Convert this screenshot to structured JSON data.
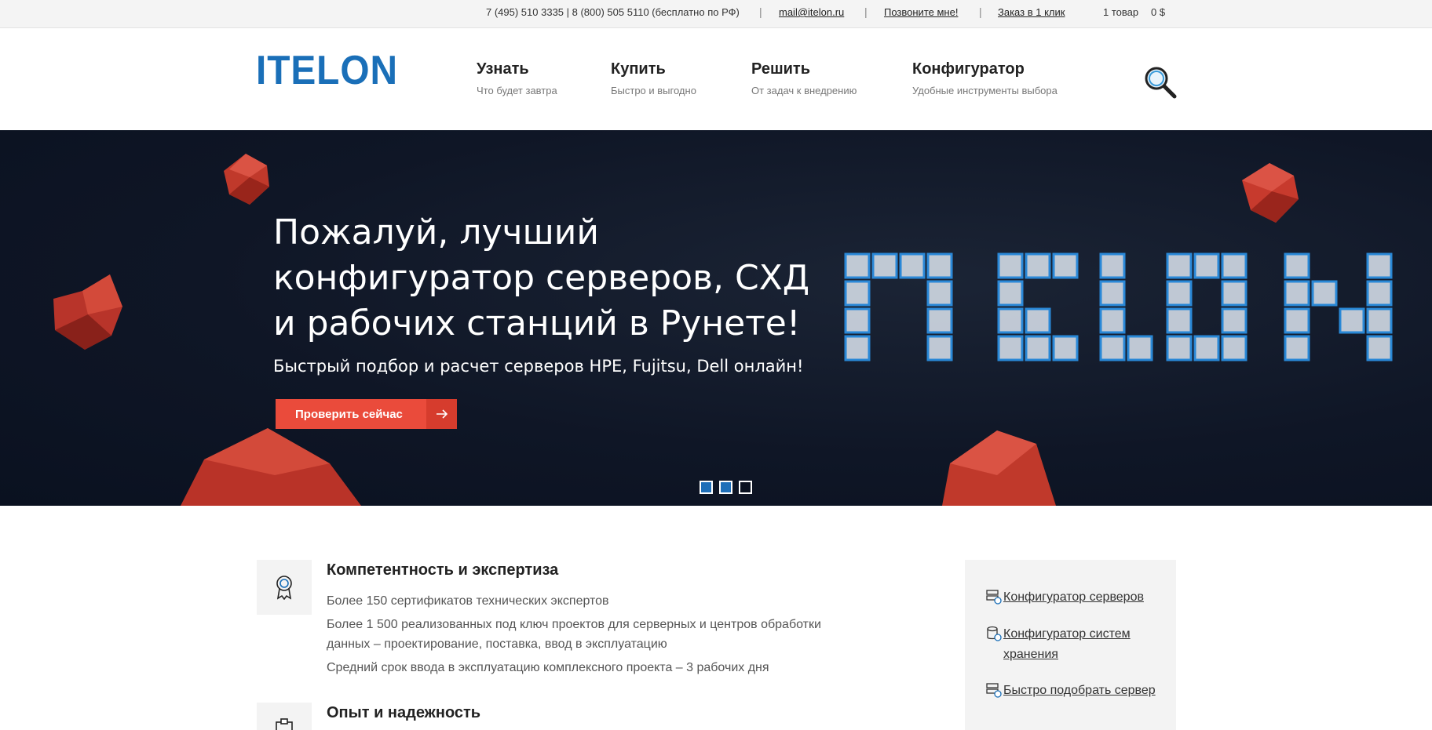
{
  "topbar": {
    "phones": "7 (495) 510 3335 | 8 (800) 505 5110 (бесплатно по РФ)",
    "email": "mail@itelon.ru",
    "callback": "Позвоните мне!",
    "one_click": "Заказ в 1 клик",
    "cart_count": "1 товар",
    "cart_total": "0 $",
    "separator": "|"
  },
  "header": {
    "logo": "ITELON",
    "nav": [
      {
        "title": "Узнать",
        "sub": "Что будет завтра"
      },
      {
        "title": "Купить",
        "sub": "Быстро и выгодно"
      },
      {
        "title": "Решить",
        "sub": "От задач к внедрению"
      },
      {
        "title": "Конфигуратор",
        "sub": "Удобные инструменты выбора"
      }
    ],
    "search_icon": "search-icon"
  },
  "hero": {
    "headline": "Пожалуй, лучший конфигуратор серверов, СХД и рабочих станций в Рунете!",
    "subtitle": "Быстрый подбор и расчет серверов HPE, Fujitsu, Dell онлайн!",
    "cta_label": "Проверить сейчас",
    "cta_icon": "arrow-right-icon",
    "slides": 3,
    "active_slide": 3,
    "accent_color": "#ea4b3b",
    "background_color": "#0f1626"
  },
  "features": [
    {
      "icon": "award-badge-icon",
      "title": "Компетентность и экспертиза",
      "lines": [
        "Более 150 сертификатов технических экспертов",
        "Более 1 500 реализованных под ключ проектов для серверных и центров обработки данных – проектирование, поставка, ввод в эксплуатацию",
        "Средний срок ввода в эксплуатацию комплексного проекта – 3 рабочих дня"
      ]
    },
    {
      "icon": "clipboard-icon",
      "title": "Опыт и надежность",
      "lines": []
    }
  ],
  "sidebar": {
    "links": [
      {
        "icon": "server-config-icon",
        "label": "Конфигуратор серверов"
      },
      {
        "icon": "storage-config-icon",
        "label": "Конфигуратор  систем хранения"
      },
      {
        "icon": "server-pick-icon",
        "label": "Быстро подобрать сервер"
      }
    ]
  },
  "colors": {
    "brand_blue": "#1a6fb8",
    "accent_red": "#ea4b3b"
  }
}
